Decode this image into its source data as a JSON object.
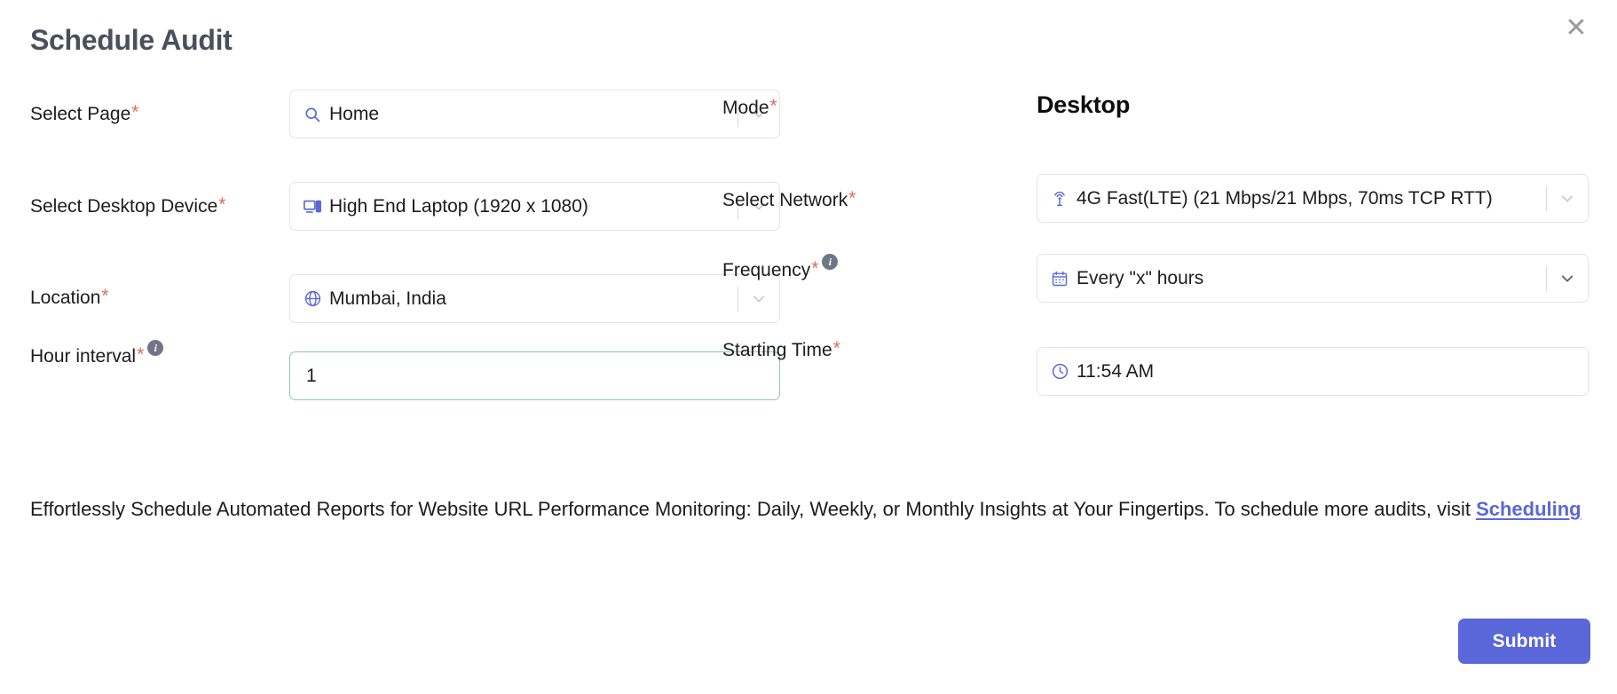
{
  "modal": {
    "title": "Schedule Audit",
    "close_label": "✕"
  },
  "fields": {
    "select_page": {
      "label": "Select Page",
      "required": "*",
      "value": "Home",
      "icon": "search-icon"
    },
    "select_desktop_device": {
      "label": "Select Desktop Device",
      "required": "*",
      "value": "High End Laptop (1920 x 1080)",
      "icon": "monitor-icon"
    },
    "location": {
      "label": "Location",
      "required": "*",
      "value": "Mumbai, India",
      "icon": "globe-icon"
    },
    "hour_interval": {
      "label": "Hour interval",
      "required": "*",
      "info": "i",
      "value": "1",
      "placeholder": "1"
    },
    "mode": {
      "label": "Mode",
      "required": "*",
      "value": "Desktop"
    },
    "select_network": {
      "label": "Select Network",
      "required": "*",
      "value": "4G Fast(LTE) (21 Mbps/21 Mbps, 70ms TCP RTT)",
      "icon": "signal-tower-icon"
    },
    "frequency": {
      "label": "Frequency",
      "required": "*",
      "info": "i",
      "value": "Every \"x\" hours",
      "icon": "calendar-icon"
    },
    "starting_time": {
      "label": "Starting Time",
      "required": "*",
      "value": "11:54 AM",
      "icon": "clock-icon"
    }
  },
  "description": {
    "text_before": "Effortlessly Schedule Automated Reports for Website URL Performance Monitoring: Daily, Weekly, or Monthly Insights at Your Fingertips. To schedule more audits, visit",
    "link": "Scheduling"
  },
  "actions": {
    "submit_label": "Submit"
  },
  "colors": {
    "accent": "#5a67d8",
    "required_asterisk": "#e06a5e",
    "icon_blue": "#5a67d8",
    "focus_border": "#8ec7b4",
    "title": "#4a4f5c"
  }
}
